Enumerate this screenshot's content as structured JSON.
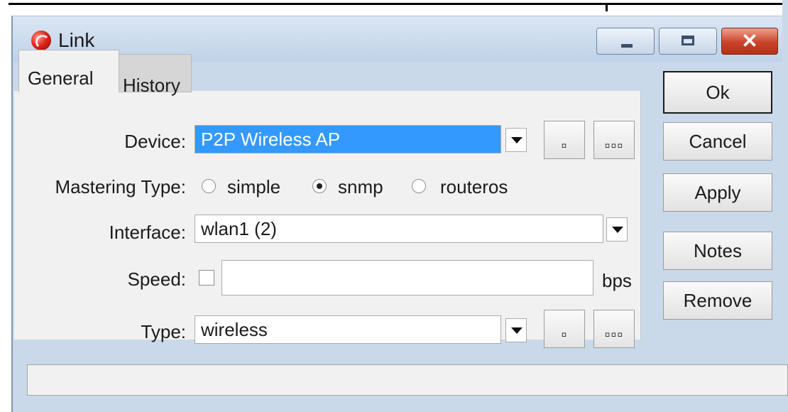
{
  "window": {
    "title": "Link",
    "icon": "mikrotik-icon",
    "controls": {
      "minimize": "minimize-icon",
      "maximize": "maximize-icon",
      "close": "close-icon",
      "close_glyph": "✕"
    }
  },
  "tabs": [
    {
      "label": "General",
      "active": true
    },
    {
      "label": "History",
      "active": false
    }
  ],
  "form": {
    "device": {
      "label": "Device:",
      "value": "P2P Wireless AP",
      "up_button": "▫",
      "browse_button": "▫▫▫"
    },
    "mastering_type": {
      "label": "Mastering Type:",
      "options": [
        {
          "label": "simple",
          "checked": false
        },
        {
          "label": "snmp",
          "checked": true
        },
        {
          "label": "routeros",
          "checked": false
        }
      ]
    },
    "interface": {
      "label": "Interface:",
      "value": "wlan1 (2)"
    },
    "speed": {
      "label": "Speed:",
      "checked": false,
      "value": "",
      "unit": "bps"
    },
    "type": {
      "label": "Type:",
      "value": "wireless",
      "up_button": "▫",
      "browse_button": "▫▫▫"
    }
  },
  "buttons": {
    "ok": "Ok",
    "cancel": "Cancel",
    "apply": "Apply",
    "notes": "Notes",
    "remove": "Remove"
  },
  "status_bar": {
    "text": ""
  },
  "colors": {
    "selection": "#3399ff",
    "window_frame": "#c9d9ea",
    "close_button": "#c9432a"
  }
}
